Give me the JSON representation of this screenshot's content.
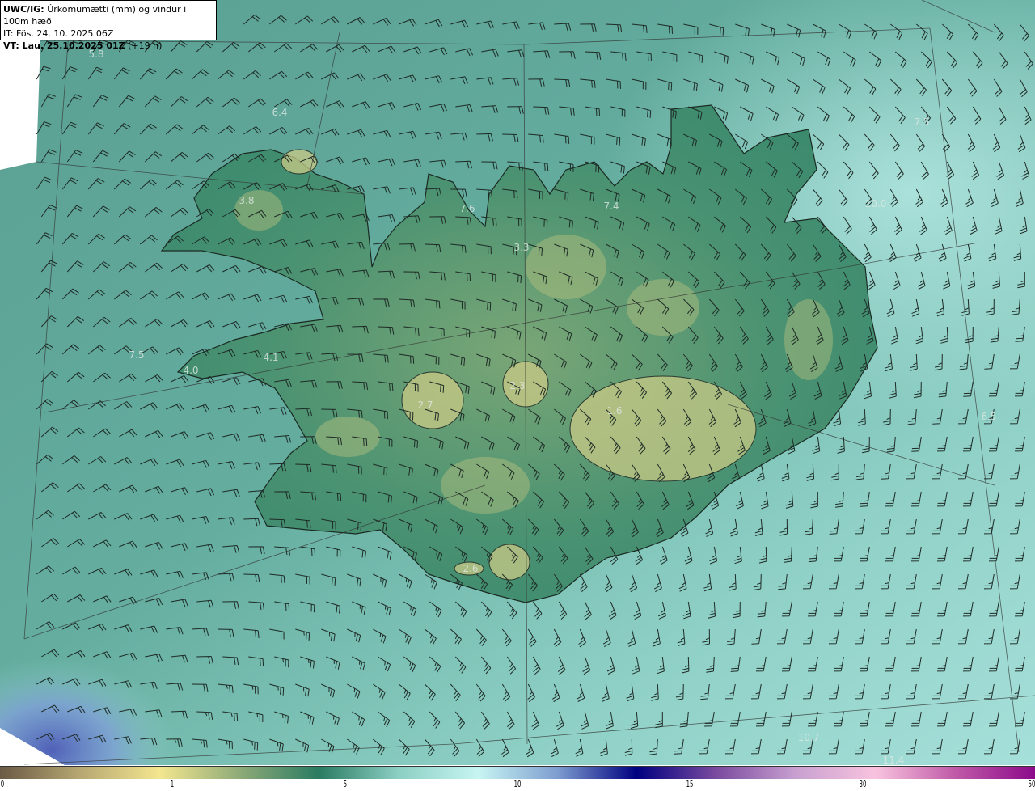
{
  "header": {
    "model": "UWC/IG:",
    "product": "Úrkomumætti (mm) og vindur i 100m hæð",
    "init_time": "IT: Fös. 24. 10. 2025 06Z",
    "valid_prefix": "VT: Lau. 25.10.2025 01Z",
    "lead": "(+19 h)"
  },
  "map_labels": [
    {
      "text": "5.8",
      "lon_lat_hint": "NW sea"
    },
    {
      "text": "6.4",
      "lon_lat_hint": "Westfjords north"
    },
    {
      "text": "3.8",
      "lon_lat_hint": "Westfjords"
    },
    {
      "text": "7.6",
      "lon_lat_hint": "North coast"
    },
    {
      "text": "3.3",
      "lon_lat_hint": "North interior"
    },
    {
      "text": "7.4",
      "lon_lat_hint": "North coast east"
    },
    {
      "text": "7.5",
      "lon_lat_hint": "NE sea"
    },
    {
      "text": "10.0",
      "lon_lat_hint": "NE coast"
    },
    {
      "text": "7.5",
      "lon_lat_hint": "W sea"
    },
    {
      "text": "4.1",
      "lon_lat_hint": "Snæfellsnes"
    },
    {
      "text": "4.0",
      "lon_lat_hint": "Snæfellsnes tip"
    },
    {
      "text": "2.7",
      "lon_lat_hint": "Langjökull"
    },
    {
      "text": "2.3",
      "lon_lat_hint": "Hofsjökull"
    },
    {
      "text": "1.6",
      "lon_lat_hint": "Vatnajökull"
    },
    {
      "text": "6.5",
      "lon_lat_hint": "E sea"
    },
    {
      "text": "2.6",
      "lon_lat_hint": "Eyjafjallajökull"
    },
    {
      "text": "10.7",
      "lon_lat_hint": "SE sea"
    },
    {
      "text": "11.4",
      "lon_lat_hint": "SE sea far"
    }
  ],
  "colorbar": {
    "ticks": [
      "0",
      "1",
      "5",
      "10",
      "15",
      "30",
      "50"
    ],
    "colors": [
      "#6b5a45",
      "#b6a772",
      "#f3e68f",
      "#8fab78",
      "#2a7b62",
      "#8ccfc3",
      "#c7f5f2",
      "#7e9ed0",
      "#000080",
      "#7a4a9f",
      "#c8a0d0",
      "#f8c3de",
      "#c05aa8",
      "#8b0a8a"
    ]
  },
  "colors": {
    "sea": "#5fa89a",
    "land": "#3f8a6d",
    "ice": "#c9c985",
    "outline": "#1a2a22"
  }
}
